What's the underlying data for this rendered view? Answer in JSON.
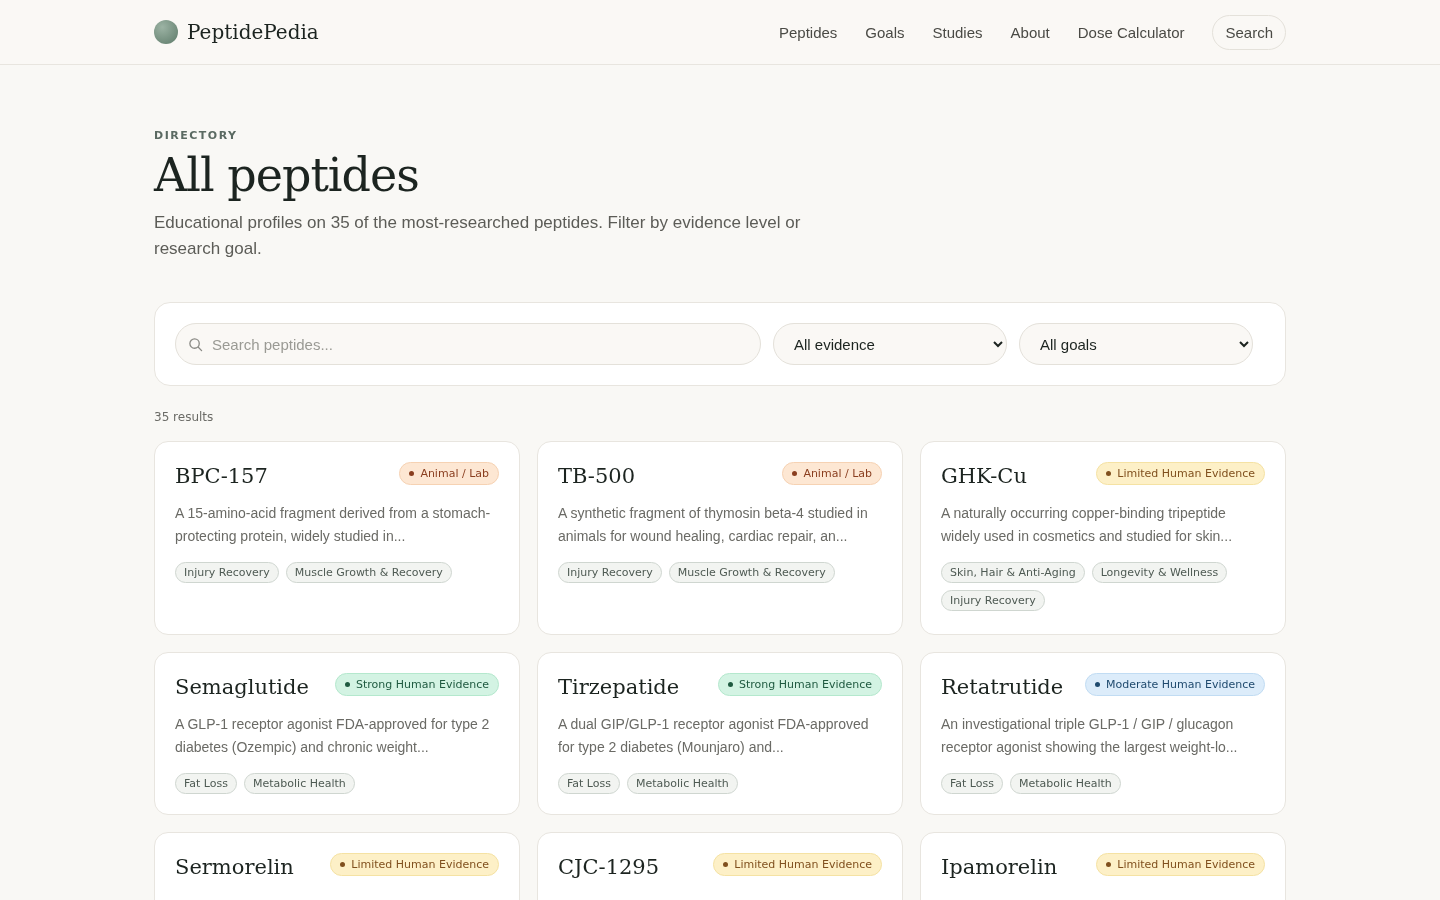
{
  "header": {
    "logo": "PeptidePedia",
    "nav": [
      "Peptides",
      "Goals",
      "Studies",
      "About",
      "Dose Calculator"
    ],
    "search_button": "Search"
  },
  "hero": {
    "eyebrow": "DIRECTORY",
    "title": "All peptides",
    "subtitle": "Educational profiles on 35 of the most-researched peptides. Filter by evidence level or research goal."
  },
  "filters": {
    "search": {
      "placeholder": "Search peptides..."
    },
    "evidence": "All evidence",
    "goals": "All goals"
  },
  "results_count": "35 results",
  "cards": [
    {
      "name": "BPC-157",
      "badge": {
        "kind": "animal",
        "label": "Animal / Lab"
      },
      "description": "A 15-amino-acid fragment derived from a stomach-protecting protein, widely studied in...",
      "tags": [
        "Injury Recovery",
        "Muscle Growth & Recovery"
      ]
    },
    {
      "name": "TB-500",
      "badge": {
        "kind": "animal",
        "label": "Animal / Lab"
      },
      "description": "A synthetic fragment of thymosin beta-4 studied in animals for wound healing, cardiac repair, an...",
      "tags": [
        "Injury Recovery",
        "Muscle Growth & Recovery"
      ]
    },
    {
      "name": "GHK-Cu",
      "badge": {
        "kind": "limited",
        "label": "Limited Human Evidence"
      },
      "description": "A naturally occurring copper-binding tripeptide widely used in cosmetics and studied for skin...",
      "tags": [
        "Skin, Hair & Anti-Aging",
        "Longevity & Wellness",
        "Injury Recovery"
      ]
    },
    {
      "name": "Semaglutide",
      "badge": {
        "kind": "strong",
        "label": "Strong Human Evidence"
      },
      "description": "A GLP-1 receptor agonist FDA-approved for type 2 diabetes (Ozempic) and chronic weight...",
      "tags": [
        "Fat Loss",
        "Metabolic Health"
      ]
    },
    {
      "name": "Tirzepatide",
      "badge": {
        "kind": "strong",
        "label": "Strong Human Evidence"
      },
      "description": "A dual GIP/GLP-1 receptor agonist FDA-approved for type 2 diabetes (Mounjaro) and...",
      "tags": [
        "Fat Loss",
        "Metabolic Health"
      ]
    },
    {
      "name": "Retatrutide",
      "badge": {
        "kind": "moderate",
        "label": "Moderate Human Evidence"
      },
      "description": "An investigational triple GLP-1 / GIP / glucagon receptor agonist showing the largest weight-lo...",
      "tags": [
        "Fat Loss",
        "Metabolic Health"
      ]
    },
    {
      "name": "Sermorelin",
      "badge": {
        "kind": "limited",
        "label": "Limited Human Evidence"
      }
    },
    {
      "name": "CJC-1295",
      "badge": {
        "kind": "limited",
        "label": "Limited Human Evidence"
      }
    },
    {
      "name": "Ipamorelin",
      "badge": {
        "kind": "limited",
        "label": "Limited Human Evidence"
      }
    }
  ]
}
